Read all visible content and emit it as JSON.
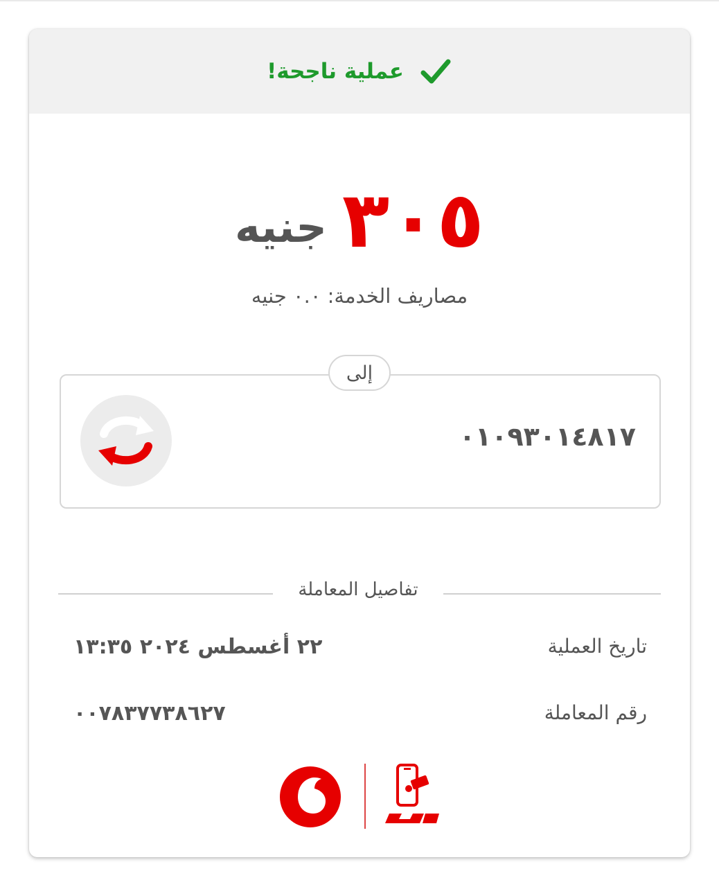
{
  "header": {
    "status_text": "عملية ناجحة!",
    "status_color": "#1e9a2c",
    "icon": "checkmark-icon"
  },
  "amount": {
    "value": "٣٠٥",
    "currency": "جنيه",
    "value_color": "#e60000"
  },
  "fee": {
    "text": "مصاريف الخدمة: ٠.٠ جنيه"
  },
  "recipient": {
    "label": "إلى",
    "number": "٠١٠٩٣٠١٤٨١٧",
    "icon": "transfer-arrows-icon"
  },
  "details": {
    "title": "تفاصيل المعاملة",
    "rows": [
      {
        "label": "تاريخ العملية",
        "value": "٢٢ أغسطس ٢٠٢٤  ١٣:٣٥"
      },
      {
        "label": "رقم المعاملة",
        "value": "٠٠٧٨٣٧٧٣٨٦٢٧"
      }
    ]
  },
  "footer": {
    "brand_logos": [
      "vodafone-logo",
      "vodafone-cash-logo"
    ],
    "brand_color": "#e60000"
  }
}
